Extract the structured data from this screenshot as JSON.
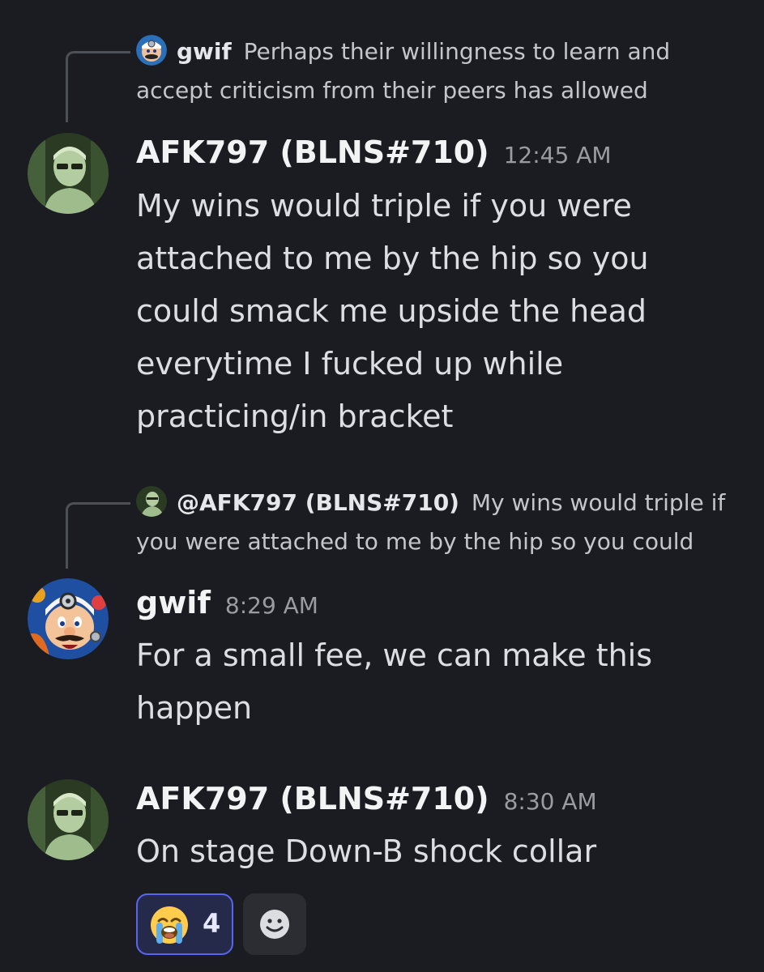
{
  "messages": [
    {
      "reply": {
        "author": "gwif",
        "text": "Perhaps their willingness to learn and accept criticism from their peers has allowed"
      },
      "author": "AFK797 (BLNS#710)",
      "time": "12:45 AM",
      "lines": [
        "My wins would triple if you were",
        "attached to me by the hip so you",
        "could smack me upside the head",
        "everytime I fucked up while",
        "practicing/in bracket"
      ]
    },
    {
      "reply": {
        "author": "@AFK797 (BLNS#710)",
        "text": "My wins would triple if you were attached to me by the hip so you could"
      },
      "author": "gwif",
      "time": "8:29 AM",
      "lines": [
        "For a small fee, we can make this",
        "happen"
      ]
    },
    {
      "author": "AFK797 (BLNS#710)",
      "time": "8:30 AM",
      "lines": [
        "On stage Down-B shock collar"
      ],
      "reactions": [
        {
          "emoji": "loudly-crying-face",
          "count": "4",
          "active": true
        }
      ]
    }
  ],
  "colors": {
    "background": "#1b1c21",
    "reaction_border": "#5865f2",
    "reaction_bg": "#252a4a"
  }
}
